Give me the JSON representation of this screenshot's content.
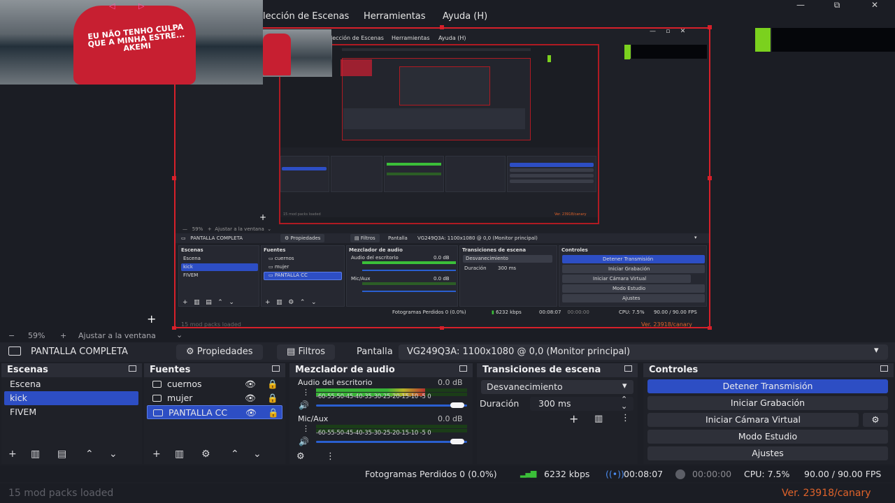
{
  "menu": {
    "scenes": "lección de Escenas",
    "tools": "Herramientas",
    "help": "Ayuda (H)"
  },
  "window": {
    "minimize": "—",
    "restore": "⧉",
    "close": "✕"
  },
  "photo": {
    "shirt_text": "EU NÃO TENHO CULPA QUE A MINHA ESTRE... AKEMI"
  },
  "nested": {
    "menu_scenes": "lección de Escenas",
    "menu_tools": "Herramientas",
    "menu_help": "Ayuda (H)",
    "zoom": "59%",
    "fit": "Ajustar a la ventana",
    "source_name": "PANTALLA COMPLETA",
    "props": "Propiedades",
    "filters": "Filtros",
    "screen_label": "Pantalla",
    "monitor": "VG249Q3A: 1100x1080 @ 0,0 (Monitor principal)",
    "scenes_title": "Escenas",
    "sources_title": "Fuentes",
    "mixer_title": "Mezclador de audio",
    "transitions_title": "Transiciones de escena",
    "controls_title": "Controles",
    "scene_items": [
      "Escena",
      "kick",
      "FIVEM"
    ],
    "source_items": [
      "cuernos",
      "mujer",
      "PANTALLA CC"
    ],
    "desktop_audio": "Audio del escritorio",
    "mic": "Mic/Aux",
    "db": "0.0 dB",
    "fade": "Desvanecimiento",
    "duration": "Duración",
    "duration_val": "300 ms",
    "ctrl": [
      "Detener Transmisión",
      "Iniciar Grabación",
      "Iniciar Cámara Virtual",
      "Modo Estudio",
      "Ajustes"
    ],
    "status": "Fotogramas Perdidos 0 (0.0%)",
    "kbps": "6232 kbps",
    "time": "00:08:07",
    "time2": "00:00:00",
    "cpu": "CPU: 7.5%",
    "fps": "90.00 / 90.00 FPS",
    "mods": "15 mod packs loaded",
    "version": "Ver. 23918/canary"
  },
  "zoombar": {
    "minus": "−",
    "zoom": "59%",
    "plus": "+",
    "fit": "Ajustar a la ventana"
  },
  "source_toolbar": {
    "source_name": "PANTALLA COMPLETA",
    "properties": "Propiedades",
    "filters": "Filtros",
    "screen_label": "Pantalla",
    "monitor": "VG249Q3A: 1100x1080 @ 0,0 (Monitor principal)"
  },
  "scenes": {
    "title": "Escenas",
    "items": [
      "Escena",
      "kick",
      "FIVEM"
    ],
    "selected": 1
  },
  "sources": {
    "title": "Fuentes",
    "items": [
      "cuernos",
      "mujer",
      "PANTALLA CC"
    ],
    "selected": 2
  },
  "mixer": {
    "title": "Mezclador de audio",
    "channels": [
      {
        "name": "Audio del escritorio",
        "db": "0.0 dB",
        "level": 0.72
      },
      {
        "name": "Mic/Aux",
        "db": "0.0 dB",
        "level": 0.0
      }
    ],
    "ticks": "-60-55-50-45-40-35-30-25-20-15-10 -5  0"
  },
  "transitions": {
    "title": "Transiciones de escena",
    "type": "Desvanecimiento",
    "duration_label": "Duración",
    "duration_value": "300 ms"
  },
  "controls": {
    "title": "Controles",
    "stop_stream": "Detener Transmisión",
    "start_recording": "Iniciar Grabación",
    "start_virtual_cam": "Iniciar Cámara Virtual",
    "studio_mode": "Modo Estudio",
    "settings": "Ajustes"
  },
  "status": {
    "dropped_frames": "Fotogramas Perdidos 0 (0.0%)",
    "bitrate": "6232 kbps",
    "stream_time": "00:08:07",
    "record_time": "00:00:00",
    "cpu": "CPU: 7.5%",
    "fps": "90.00 / 90.00 FPS"
  },
  "footer": {
    "mods": "15 mod packs loaded",
    "version": "Ver. 23918/canary"
  },
  "colors": {
    "accent": "#2d4ec4",
    "selection_red": "#d7202a",
    "version_orange": "#e0632a",
    "meter_green": "#3bbf39"
  }
}
